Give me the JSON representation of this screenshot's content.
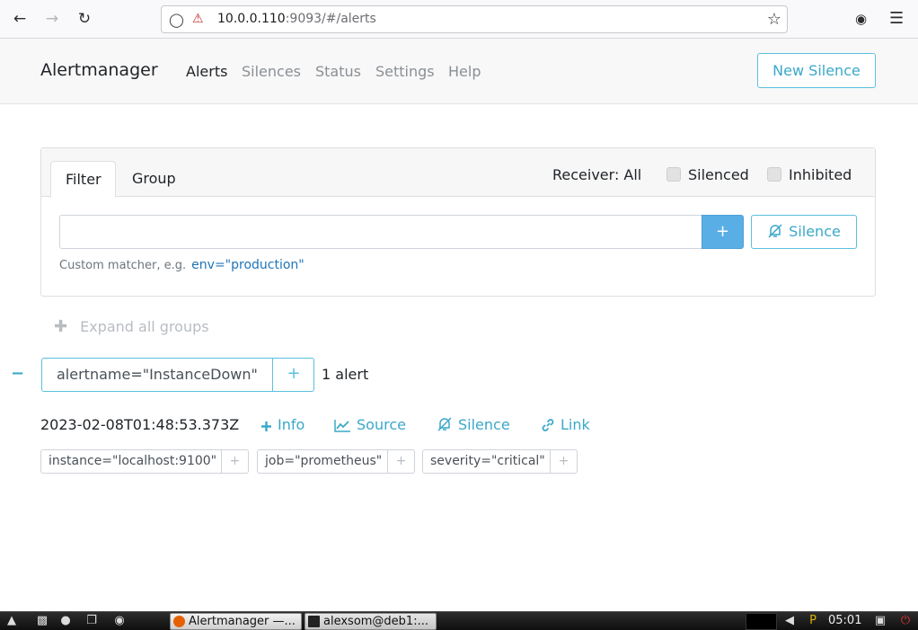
{
  "browser": {
    "url_host": "10.0.0.110",
    "url_rest": ":9093/#/alerts"
  },
  "navbar": {
    "brand": "Alertmanager",
    "links": [
      "Alerts",
      "Silences",
      "Status",
      "Settings",
      "Help"
    ],
    "active": "Alerts",
    "new_silence": "New Silence"
  },
  "filter": {
    "tabs": [
      "Filter",
      "Group"
    ],
    "active_tab": "Filter",
    "receiver": "Receiver: All",
    "silenced_label": "Silenced",
    "silenced_checked": false,
    "inhibited_label": "Inhibited",
    "inhibited_checked": false,
    "input_value": "",
    "add_button": "+",
    "silence_button": "Silence",
    "hint": "Custom matcher, e.g.",
    "hint_example": "env=\"production\""
  },
  "expand_all": "Expand all groups",
  "group": {
    "collapse_symbol": "−",
    "label": "alertname=\"InstanceDown\"",
    "add_symbol": "+",
    "count": "1 alert"
  },
  "alert": {
    "timestamp": "2023-02-08T01:48:53.373Z",
    "actions": [
      "Info",
      "Source",
      "Silence",
      "Link"
    ],
    "labels": [
      "instance=\"localhost:9100\"",
      "job=\"prometheus\"",
      "severity=\"critical\""
    ]
  },
  "taskbar": {
    "tasks": [
      "Alertmanager —...",
      "alexsom@deb1:..."
    ],
    "clock": "05:01",
    "colors": {
      "firefox": "#e66000",
      "terminal": "#222222"
    }
  },
  "colors": {
    "accent": "#5bc0de",
    "primary": "#5aaee6",
    "link": "#1f74b8"
  }
}
